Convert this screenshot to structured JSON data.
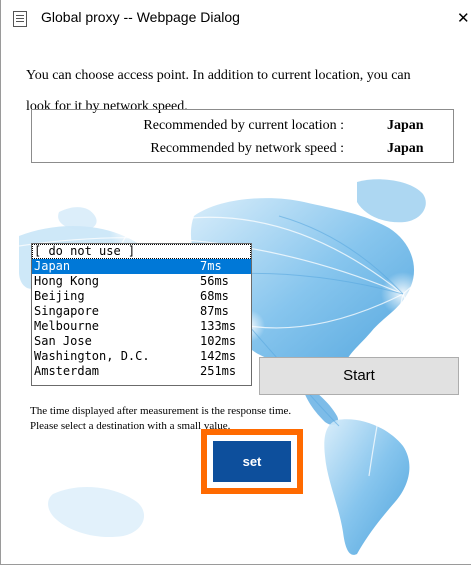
{
  "window": {
    "title": "Global proxy -- Webpage Dialog",
    "close_glyph": "✕"
  },
  "intro": {
    "line1": "You can choose access point. In addition to current location, you can",
    "line2": "look for it by network speed."
  },
  "recommendation": {
    "by_location_label": "Recommended by current location :",
    "by_location_value": "Japan",
    "by_speed_label": "Recommended by network speed :",
    "by_speed_value": "Japan"
  },
  "access_points": {
    "items": [
      {
        "name": "[ do not use ]",
        "ms": ""
      },
      {
        "name": "Japan",
        "ms": "7ms"
      },
      {
        "name": "Hong Kong",
        "ms": "56ms"
      },
      {
        "name": "Beijing",
        "ms": "68ms"
      },
      {
        "name": "Singapore",
        "ms": "87ms"
      },
      {
        "name": "Melbourne",
        "ms": "133ms"
      },
      {
        "name": "San Jose",
        "ms": "102ms"
      },
      {
        "name": "Washington, D.C.",
        "ms": "142ms"
      },
      {
        "name": "Amsterdam",
        "ms": "251ms"
      }
    ],
    "selected": "Japan"
  },
  "buttons": {
    "start_label": "Start",
    "set_label": "set"
  },
  "note": {
    "line1": "The time displayed after measurement is the response time.",
    "line2": "Please select a destination with a small value."
  },
  "colors": {
    "selection": "#0078d7",
    "set_button": "#0d4f9c",
    "highlight": "#ff6a00",
    "map": "#4aa3df"
  }
}
